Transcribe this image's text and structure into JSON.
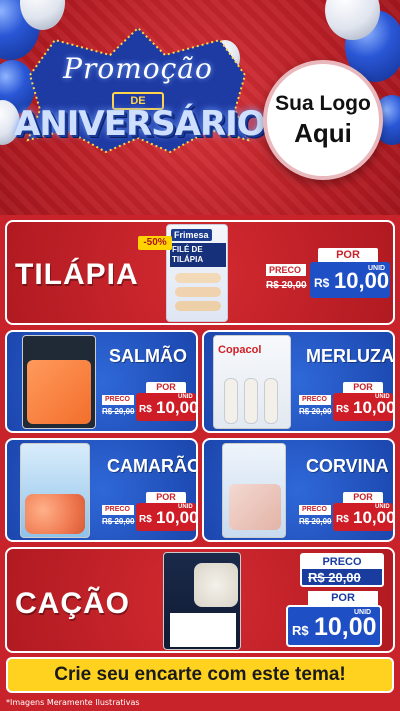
{
  "header": {
    "title_line1": "Promoção",
    "title_line2": "DE",
    "title_line3": "ANIVERSÁRIO",
    "logo_line1": "Sua Logo",
    "logo_line2": "Aqui"
  },
  "products": [
    {
      "name": "TILÁPIA",
      "product_label": "FILÉ DE TILÁPIA",
      "brand": "Frimesa",
      "discount": "-50%",
      "preco_label": "PRECO",
      "old_price": "R$ 20,00",
      "por_label": "POR",
      "currency": "R$",
      "new_price": "10,00",
      "unit": "UNID"
    },
    {
      "name": "SALMÃO",
      "preco_label": "PRECO",
      "old_price": "R$ 20,00",
      "por_label": "POR",
      "currency": "R$",
      "new_price": "10,00",
      "unit": "UNID"
    },
    {
      "name": "MERLUZA",
      "brand": "Copacol",
      "preco_label": "PRECO",
      "old_price": "R$ 20,00",
      "por_label": "POR",
      "currency": "R$",
      "new_price": "10,00",
      "unit": "UNID"
    },
    {
      "name": "CAMARÃO",
      "preco_label": "PRECO",
      "old_price": "R$ 20,00",
      "por_label": "POR",
      "currency": "R$",
      "new_price": "10,00",
      "unit": "UNID"
    },
    {
      "name": "CORVINA",
      "preco_label": "PRECO",
      "old_price": "R$ 20,00",
      "por_label": "POR",
      "currency": "R$",
      "new_price": "10,00",
      "unit": "UNID"
    },
    {
      "name": "CAÇÃO",
      "preco_label": "PRECO",
      "old_price": "R$ 20,00",
      "por_label": "POR",
      "currency": "R$",
      "new_price": "10,00",
      "unit": "UNID"
    }
  ],
  "banner": "Crie seu encarte com este tema!",
  "footnote": "*Imagens Meramente Ilustrativas",
  "colors": {
    "red": "#c8232a",
    "blue": "#1f4fc4",
    "yellow": "#ffd21f"
  }
}
